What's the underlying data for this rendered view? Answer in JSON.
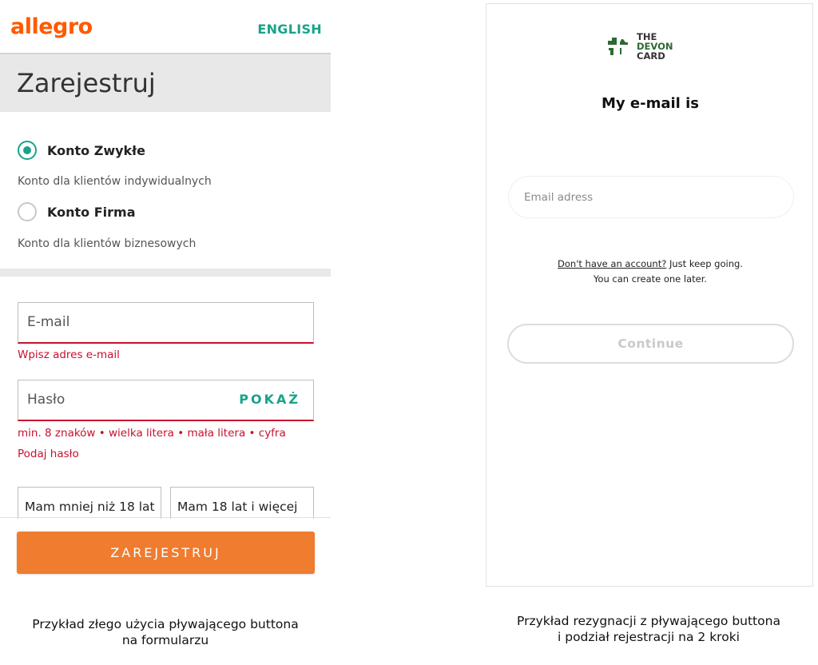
{
  "left_panel": {
    "logo": "allegro",
    "language_link": "ENGLISH",
    "title": "Zarejestruj",
    "account_types": [
      {
        "label": "Konto Zwykłe",
        "description": "Konto dla klientów indywidualnych",
        "selected": true
      },
      {
        "label": "Konto Firma",
        "description": "Konto dla klientów biznesowych",
        "selected": false
      }
    ],
    "email_field": {
      "placeholder": "E-mail",
      "error": "Wpisz adres e-mail"
    },
    "password_field": {
      "placeholder": "Hasło",
      "show_label": "POKAŻ",
      "hint": "min. 8 znaków • wielka litera • mała litera • cyfra",
      "error": "Podaj hasło"
    },
    "age_options": [
      "Mam mniej niż 18 lat",
      "Mam 18 lat i więcej"
    ],
    "submit_label": "ZAREJESTRUJ",
    "colors": {
      "brand": "#ff5a00",
      "accent": "#19a38a",
      "error": "#c8102e",
      "cta": "#ef7c2f"
    }
  },
  "right_panel": {
    "logo_lines": [
      "THE",
      "DEVON",
      "CARD"
    ],
    "heading": "My e-mail is",
    "email_placeholder": "Email adress",
    "note_link": "Don't have an account?",
    "note_rest": " Just keep going.",
    "note_line2": "You can create one later.",
    "continue_label": "Continue",
    "colors": {
      "brand_green": "#2d6a31"
    }
  },
  "captions": {
    "left_line1": "Przykład złego użycia pływającego buttona",
    "left_line2": "na formularzu",
    "right_line1": "Przykład rezygnacji z pływającego buttona",
    "right_line2": "i podział rejestracji na 2 kroki"
  }
}
